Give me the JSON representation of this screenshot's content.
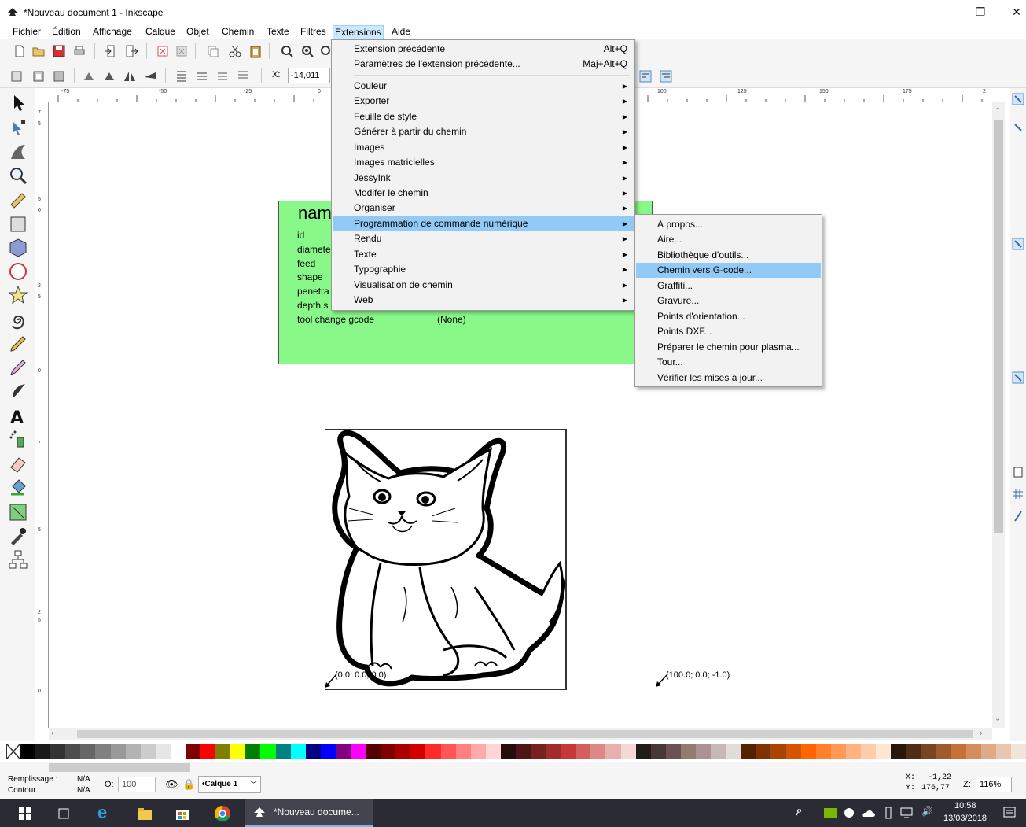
{
  "window": {
    "title": "*Nouveau document 1 - Inkscape",
    "controls": {
      "minimize": "–",
      "restore": "❐",
      "close": "✕"
    }
  },
  "menubar": {
    "items": [
      "Fichier",
      "Édition",
      "Affichage",
      "Calque",
      "Objet",
      "Chemin",
      "Texte",
      "Filtres",
      "Extensions",
      "Aide"
    ],
    "active": "Extensions"
  },
  "toolbar2": {
    "x_label": "X:",
    "x_value": "-14,011"
  },
  "ruler": {
    "h_labels": [
      "-75",
      "-50",
      "-25",
      "0",
      "100",
      "125",
      "150",
      "175",
      "2"
    ],
    "v_labels": [
      "7",
      "5",
      "5",
      "0",
      "2",
      "5",
      "0",
      "7",
      "5",
      "2",
      "5",
      "0"
    ]
  },
  "greenbox": {
    "name": "nam",
    "rows": [
      {
        "label": "id",
        "value": ""
      },
      {
        "label": "diamete",
        "value": ""
      },
      {
        "label": "feed",
        "value": ""
      },
      {
        "label": "shape",
        "value": ""
      },
      {
        "label": "penetra",
        "value": ""
      },
      {
        "label": "depth s",
        "value": ""
      },
      {
        "label": "tool change gcode",
        "value": "(None)"
      }
    ],
    "color": "#88f888"
  },
  "coords": {
    "origin": "(0.0; 0.0; 0.0)",
    "second": "(100.0; 0.0; -1.0)"
  },
  "extensions_menu": {
    "items": [
      {
        "label": "Extension précédente",
        "shortcut": "Alt+Q",
        "submenu": false
      },
      {
        "label": "Paramètres de l'extension précédente...",
        "shortcut": "Maj+Alt+Q",
        "submenu": false
      },
      {
        "label": "Couleur",
        "shortcut": "",
        "submenu": true
      },
      {
        "label": "Exporter",
        "shortcut": "",
        "submenu": true
      },
      {
        "label": "Feuille de style",
        "shortcut": "",
        "submenu": true
      },
      {
        "label": "Générer à partir du chemin",
        "shortcut": "",
        "submenu": true
      },
      {
        "label": "Images",
        "shortcut": "",
        "submenu": true
      },
      {
        "label": "Images matricielles",
        "shortcut": "",
        "submenu": true
      },
      {
        "label": "JessyInk",
        "shortcut": "",
        "submenu": true
      },
      {
        "label": "Modifer le chemin",
        "shortcut": "",
        "submenu": true
      },
      {
        "label": "Organiser",
        "shortcut": "",
        "submenu": true
      },
      {
        "label": "Programmation de commande numérique",
        "shortcut": "",
        "submenu": true
      },
      {
        "label": "Rendu",
        "shortcut": "",
        "submenu": true
      },
      {
        "label": "Texte",
        "shortcut": "",
        "submenu": true
      },
      {
        "label": "Typographie",
        "shortcut": "",
        "submenu": true
      },
      {
        "label": "Visualisation de chemin",
        "shortcut": "",
        "submenu": true
      },
      {
        "label": "Web",
        "shortcut": "",
        "submenu": true
      }
    ],
    "highlighted": "Programmation de commande numérique"
  },
  "submenu": {
    "items": [
      "À propos...",
      "Aire...",
      "Bibliothèque d'outils...",
      "Chemin vers G-code...",
      "Graffiti...",
      "Gravure...",
      "Points d'orientation...",
      "Points DXF...",
      "Préparer le chemin pour plasma...",
      "Tour...",
      "Vérifier les mises à jour..."
    ],
    "highlighted": "Chemin vers G-code..."
  },
  "palette": {
    "colors": [
      "#000000",
      "#1a1a1a",
      "#333333",
      "#4d4d4d",
      "#666666",
      "#808080",
      "#999999",
      "#b3b3b3",
      "#cccccc",
      "#e6e6e6",
      "#ffffff",
      "#800000",
      "#ff0000",
      "#808000",
      "#ffff00",
      "#008000",
      "#00ff00",
      "#008080",
      "#00ffff",
      "#000080",
      "#0000ff",
      "#800080",
      "#ff00ff",
      "#550000",
      "#800000",
      "#aa0000",
      "#d40000",
      "#ff2a2a",
      "#ff5555",
      "#ff8080",
      "#ffaaaa",
      "#ffd5d5",
      "#280b0b",
      "#501616",
      "#782121",
      "#a02c2c",
      "#c83737",
      "#d35f5f",
      "#de8787",
      "#e9afaf",
      "#f4d7d7",
      "#241c1c",
      "#483737",
      "#6c5353",
      "#917c6f",
      "#ac9393",
      "#c8b7b7",
      "#e3dbdb",
      "#552200",
      "#803300",
      "#aa4400",
      "#d45500",
      "#ff6600",
      "#ff7f2a",
      "#ff9955",
      "#ffb380",
      "#ffccaa",
      "#ffe6d5",
      "#28170b",
      "#502d16",
      "#784421",
      "#a05a2c",
      "#c87137",
      "#d38d5f",
      "#deaa87",
      "#e9c6af",
      "#f4e3d7"
    ]
  },
  "status": {
    "fill_label": "Remplissage :",
    "fill_value": "N/A",
    "stroke_label": "Contour :",
    "stroke_value": "N/A",
    "opacity_label": "O:",
    "opacity_value": "100",
    "layer": "•Calque 1",
    "cursor_x_label": "X:",
    "cursor_x": "-1,22",
    "cursor_y_label": "Y:",
    "cursor_y": "176,77",
    "zoom_label": "Z:",
    "zoom": "116%"
  },
  "taskbar": {
    "app_label": "*Nouveau docume...",
    "time": "10:58",
    "date": "13/03/2018"
  }
}
